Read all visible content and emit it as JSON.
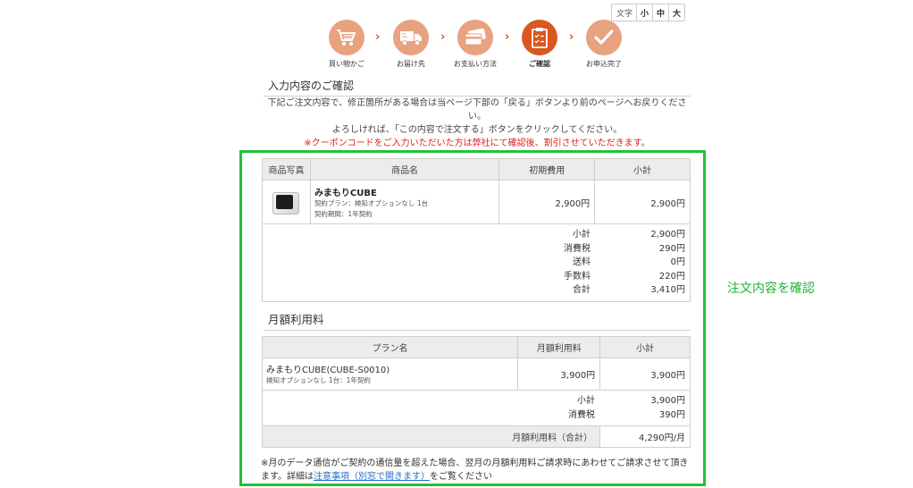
{
  "fontsize": {
    "label": "文字",
    "small": "小",
    "medium": "中",
    "large": "大"
  },
  "steps": [
    {
      "label": "買い物かご",
      "icon": "shopping-cart-icon",
      "active": false
    },
    {
      "label": "お届け先",
      "icon": "delivery-truck-icon",
      "active": false
    },
    {
      "label": "お支払い方法",
      "icon": "credit-card-icon",
      "active": false
    },
    {
      "label": "ご確認",
      "icon": "clipboard-check-icon",
      "active": true
    },
    {
      "label": "お申込完了",
      "icon": "checkmark-icon",
      "active": false
    }
  ],
  "colors": {
    "step": "#e8a27f",
    "step_active": "#d8581f",
    "highlight": "#22c13a",
    "warning": "#e02020",
    "link": "#2a6fc9"
  },
  "heading": "入力内容のご確認",
  "intro": {
    "line1": "下記ご注文内容で、修正箇所がある場合は当ページ下部の「戻る」ボタンより前のページへお戻りください。",
    "line2": "よろしければ、「この内容で注文する」ボタンをクリックしてください。",
    "warning": "※クーポンコードをご入力いただいた方は弊社にて確認後、割引させていただきます。"
  },
  "order_table": {
    "headers": [
      "商品写真",
      "商品名",
      "初期費用",
      "小計"
    ],
    "item": {
      "name": "みまもりCUBE",
      "detail1": "契約プラン：検知オプションなし 1台",
      "detail2": "契約期間：1年契約",
      "initial_fee": "2,900円",
      "subtotal": "2,900円"
    },
    "summary": [
      {
        "label": "小計",
        "value": "2,900円"
      },
      {
        "label": "消費税",
        "value": "290円"
      },
      {
        "label": "送料",
        "value": "0円"
      },
      {
        "label": "手数料",
        "value": "220円"
      },
      {
        "label": "合計",
        "value": "3,410円"
      }
    ]
  },
  "monthly_heading": "月額利用料",
  "monthly_table": {
    "headers": [
      "プラン名",
      "月額利用料",
      "小計"
    ],
    "item": {
      "name": "みまもりCUBE(CUBE-S0010)",
      "detail": "検知オプションなし 1台：1年契約",
      "monthly_fee": "3,900円",
      "subtotal": "3,900円"
    },
    "summary": [
      {
        "label": "小計",
        "value": "3,900円"
      },
      {
        "label": "消費税",
        "value": "390円"
      }
    ],
    "total_label": "月額利用料（合計）",
    "total_value": "4,290円/月"
  },
  "footnote": {
    "text1": "※月のデータ通信がご契約の通信量を超えた場合、翌月の月額利用料ご請求時にあわせてご請求させて頂きます。詳細は",
    "link": "注意事項（別窓で開きます）",
    "text2": "をご覧ください"
  },
  "callout": "注文内容を確認"
}
